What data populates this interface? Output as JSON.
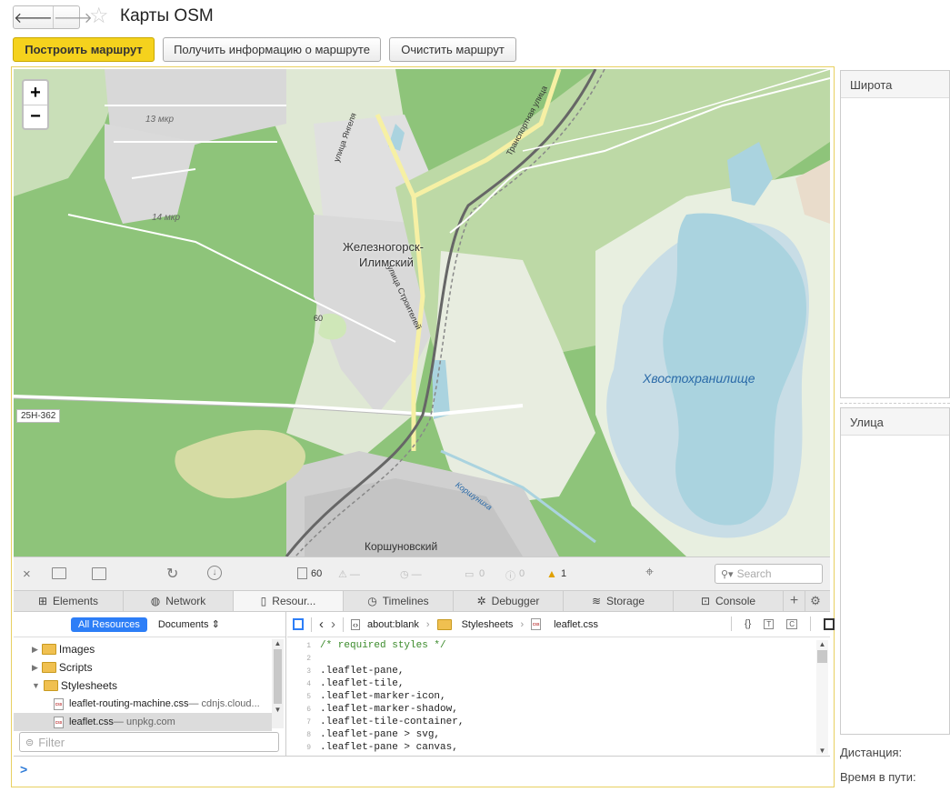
{
  "window": {
    "title": "Карты OSM"
  },
  "nav": {
    "back": "🡐",
    "forward": "🡒"
  },
  "toolbar": {
    "build_route": "Построить маршрут",
    "route_info": "Получить информацию о маршруте",
    "clear_route": "Очистить маршрут"
  },
  "map": {
    "zoom_in": "+",
    "zoom_out": "−",
    "labels": {
      "city_line1": "Железногорск-",
      "city_line2": "Илимский",
      "mkr13": "13 мкр",
      "mkr14": "14 мкр",
      "street_yangel": "улица Янгеля",
      "street_stroiteley": "улица Строителей",
      "street_transport": "Транспортная улица",
      "tailings": "Хвостохранилище",
      "road": "25Н-362",
      "korshunikha": "Коршуниха",
      "korshunovsky": "Коршуновский",
      "number60": "60"
    }
  },
  "inspector": {
    "toolbar": {
      "resources_count": "60",
      "errors": "0",
      "warnings_a": "0",
      "warnings_b": "0",
      "issues": "1",
      "search_placeholder": "Search"
    },
    "tabs": [
      "Elements",
      "Network",
      "Resour...",
      "Timelines",
      "Debugger",
      "Storage",
      "Console"
    ],
    "sidebar": {
      "all_resources": "All Resources",
      "documents": "Documents",
      "tree": [
        {
          "label": "Images"
        },
        {
          "label": "Scripts"
        },
        {
          "label": "Stylesheets"
        }
      ],
      "files": [
        {
          "name": "leaflet-routing-machine.css",
          "origin": " — cdnjs.cloud..."
        },
        {
          "name": "leaflet.css",
          "origin": " — unpkg.com"
        }
      ],
      "filter_placeholder": "Filter"
    },
    "breadcrumb": [
      "about:blank",
      "Stylesheets",
      "leaflet.css"
    ],
    "code": [
      {
        "n": "1",
        "text": "/* required styles */"
      },
      {
        "n": "2",
        "text": ""
      },
      {
        "n": "3",
        "text": ".leaflet-pane,"
      },
      {
        "n": "4",
        "text": ".leaflet-tile,"
      },
      {
        "n": "5",
        "text": ".leaflet-marker-icon,"
      },
      {
        "n": "6",
        "text": ".leaflet-marker-shadow,"
      },
      {
        "n": "7",
        "text": ".leaflet-tile-container,"
      },
      {
        "n": "8",
        "text": ".leaflet-pane > svg,"
      },
      {
        "n": "9",
        "text": ".leaflet-pane > canvas,"
      }
    ],
    "console_prompt": ">"
  },
  "right_panel": {
    "latitude_header": "Широта",
    "street_header": "Улица",
    "distance_label": "Дистанция:",
    "travel_time_label": "Время в пути:"
  },
  "colors": {
    "primary_button": "#f5d21d",
    "map_forest": "#8ec47a",
    "map_water": "#aad3df",
    "console_prompt": "#2f7bd8",
    "active_filter": "#2d7ef7"
  }
}
